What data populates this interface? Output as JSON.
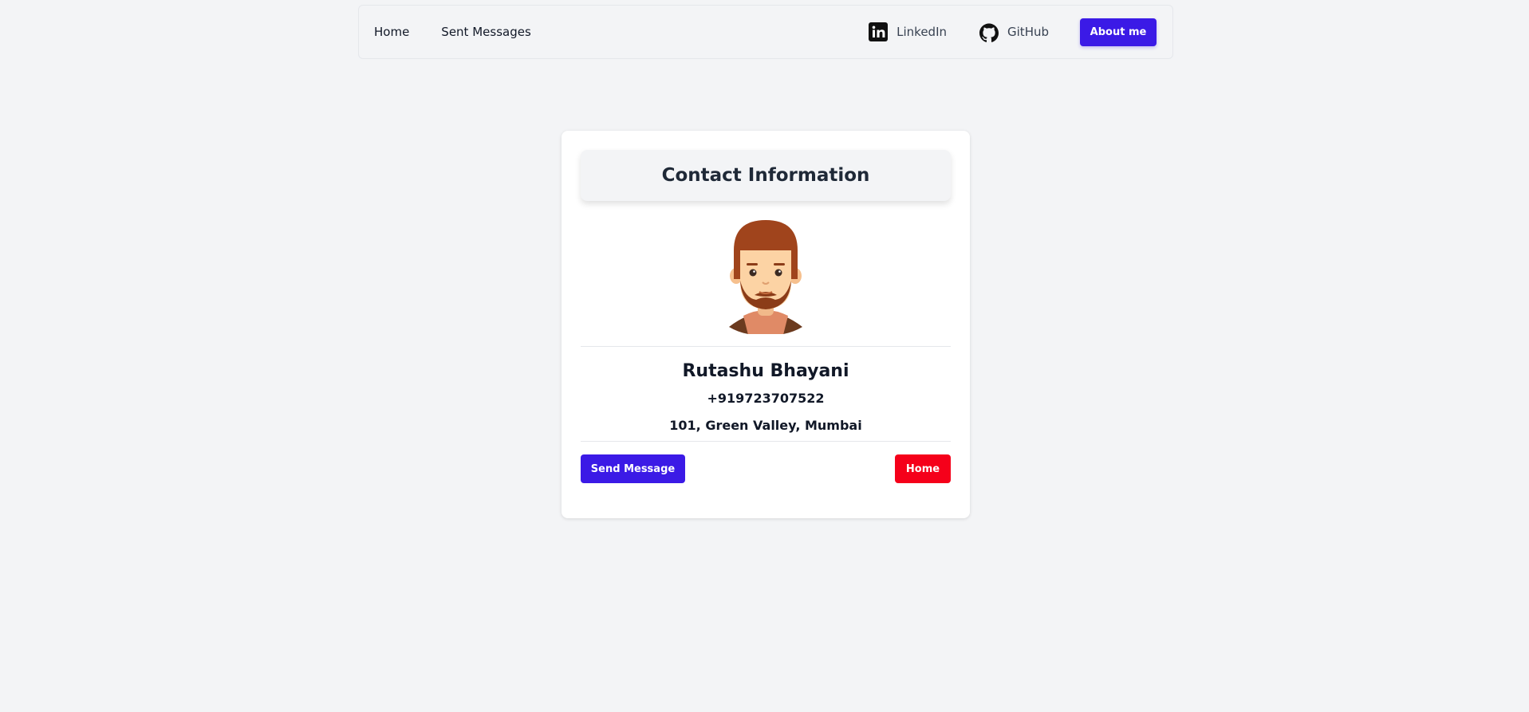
{
  "nav": {
    "home_label": "Home",
    "sent_label": "Sent Messages",
    "linkedin_label": "LinkedIn",
    "github_label": "GitHub",
    "about_label": "About me"
  },
  "card": {
    "title": "Contact Information",
    "name": "Rutashu Bhayani",
    "phone": "+919723707522",
    "address": "101, Green Valley, Mumbai",
    "send_label": "Send Message",
    "home_label": "Home"
  },
  "icons": {
    "linkedin": "linkedin-icon",
    "github": "github-icon",
    "avatar": "avatar"
  },
  "colors": {
    "primary": "#3b1ae6",
    "danger": "#f5001a",
    "background": "#f3f4f6"
  }
}
